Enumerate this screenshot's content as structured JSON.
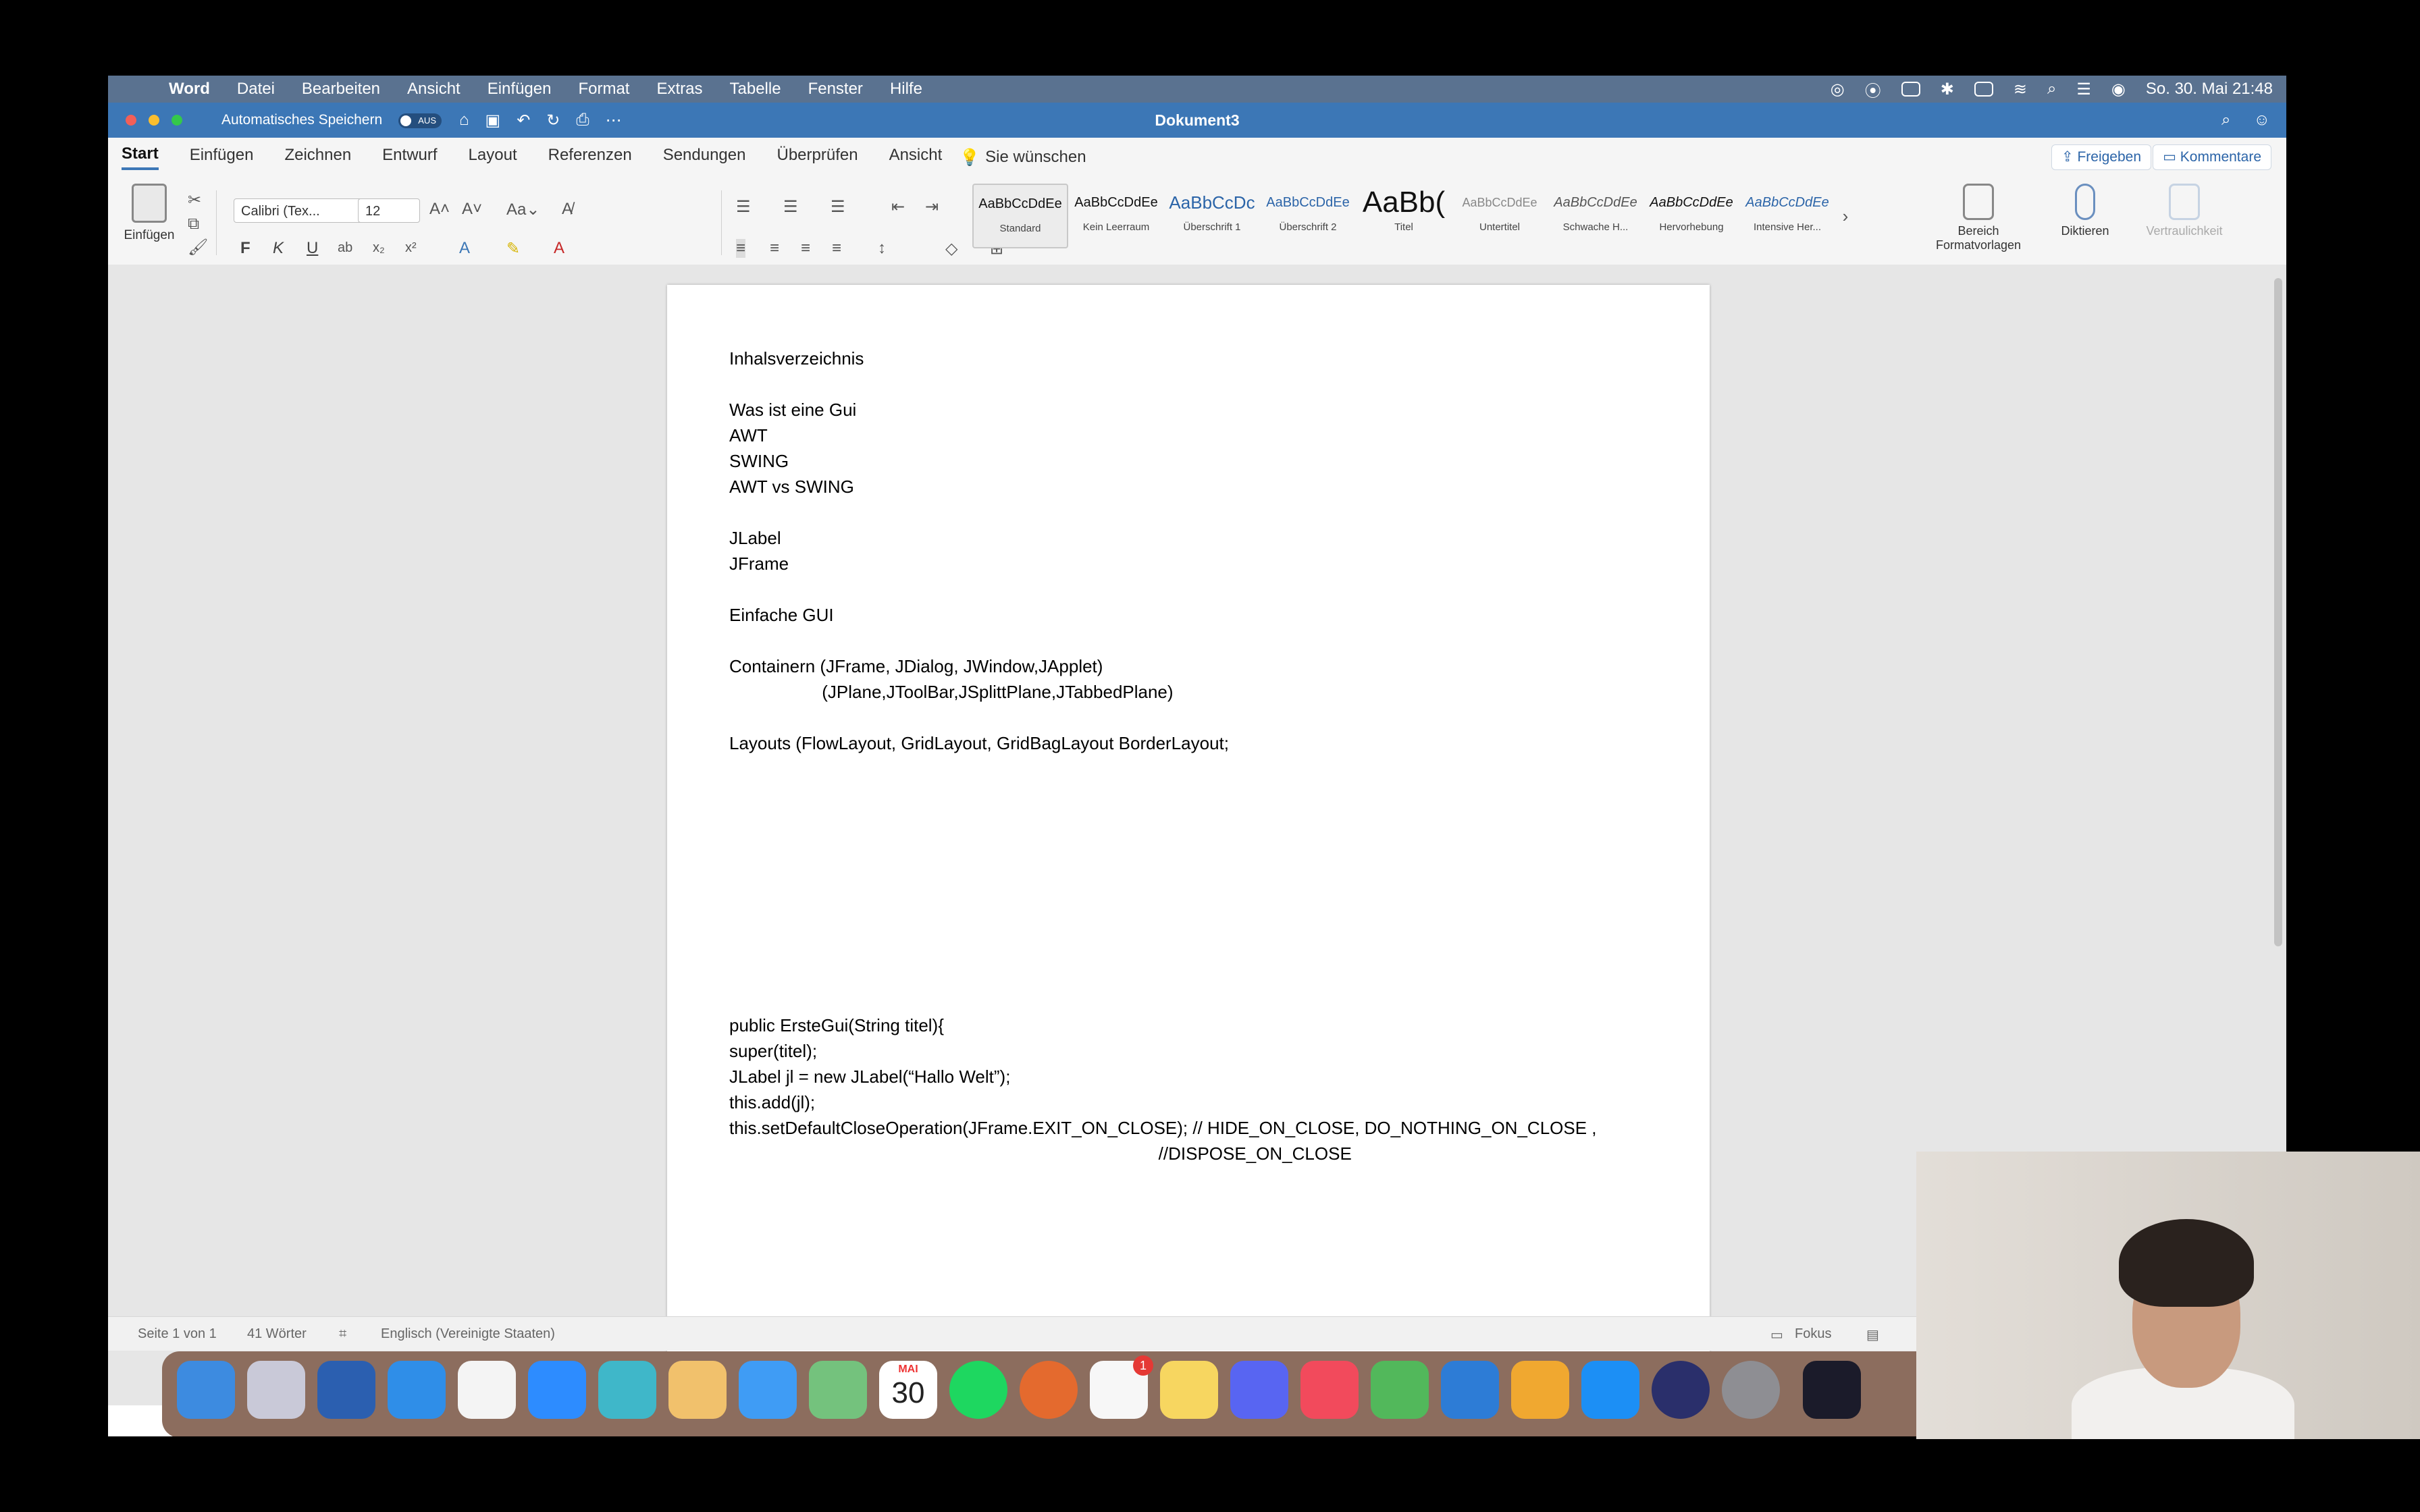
{
  "menubar": {
    "app": "Word",
    "items": [
      "Datei",
      "Bearbeiten",
      "Ansicht",
      "Einfügen",
      "Format",
      "Extras",
      "Tabelle",
      "Fenster",
      "Hilfe"
    ],
    "clock": "So. 30. Mai  21:48"
  },
  "titlebar": {
    "autosave_label": "Automatisches Speichern",
    "autosave_state": "AUS",
    "document_title": "Dokument3"
  },
  "ribbon_tabs": {
    "items": [
      "Start",
      "Einfügen",
      "Zeichnen",
      "Entwurf",
      "Layout",
      "Referenzen",
      "Sendungen",
      "Überprüfen",
      "Ansicht"
    ],
    "tell_me": "Sie wünschen",
    "share": "Freigeben",
    "comments": "Kommentare"
  },
  "ribbon": {
    "paste_label": "Einfügen",
    "font_name": "Calibri (Tex...",
    "font_size": "12",
    "bold": "F",
    "italic": "K",
    "underline": "U",
    "styles": [
      {
        "preview": "AaBbCcDdEe",
        "name": "Standard"
      },
      {
        "preview": "AaBbCcDdEe",
        "name": "Kein Leerraum"
      },
      {
        "preview": "AaBbCcDc",
        "name": "Überschrift 1"
      },
      {
        "preview": "AaBbCcDdEe",
        "name": "Überschrift 2"
      },
      {
        "preview": "AaBb(",
        "name": "Titel"
      },
      {
        "preview": "AaBbCcDdEe",
        "name": "Untertitel"
      },
      {
        "preview": "AaBbCcDdEe",
        "name": "Schwache H..."
      },
      {
        "preview": "AaBbCcDdEe",
        "name": "Hervorhebung"
      },
      {
        "preview": "AaBbCcDdEe",
        "name": "Intensive Her..."
      }
    ],
    "styles_pane_line1": "Bereich",
    "styles_pane_line2": "Formatvorlagen",
    "dictate": "Diktieren",
    "sensitivity": "Vertraulichkeit"
  },
  "document": {
    "lines": [
      "Inhalsverzeichnis",
      "",
      "Was ist eine Gui",
      "AWT",
      "SWING",
      "AWT vs SWING",
      "",
      "JLabel",
      "JFrame",
      "",
      "Einfache GUI",
      "",
      "Containern (JFrame, JDialog, JWindow,JApplet)",
      "                   (JPlane,JToolBar,JSplittPlane,JTabbedPlane)",
      "",
      "Layouts (FlowLayout, GridLayout, GridBagLayout BorderLayout;",
      "",
      "",
      "",
      "",
      "",
      "",
      "",
      "",
      "",
      "",
      "public ErsteGui(String titel){",
      "super(titel);",
      "JLabel jl = new JLabel(“Hallo Welt”);",
      "this.add(jl);",
      "this.setDefaultCloseOperation(JFrame.EXIT_ON_CLOSE); // HIDE_ON_CLOSE, DO_NOTHING_ON_CLOSE ,",
      "                                                                                        //DISPOSE_ON_CLOSE"
    ]
  },
  "statusbar": {
    "page": "Seite 1 von 1",
    "words": "41 Wörter",
    "language": "Englisch (Vereinigte Staaten)",
    "focus": "Fokus"
  },
  "dock": {
    "calendar_month": "MAI",
    "calendar_day": "30",
    "badge": "1"
  }
}
